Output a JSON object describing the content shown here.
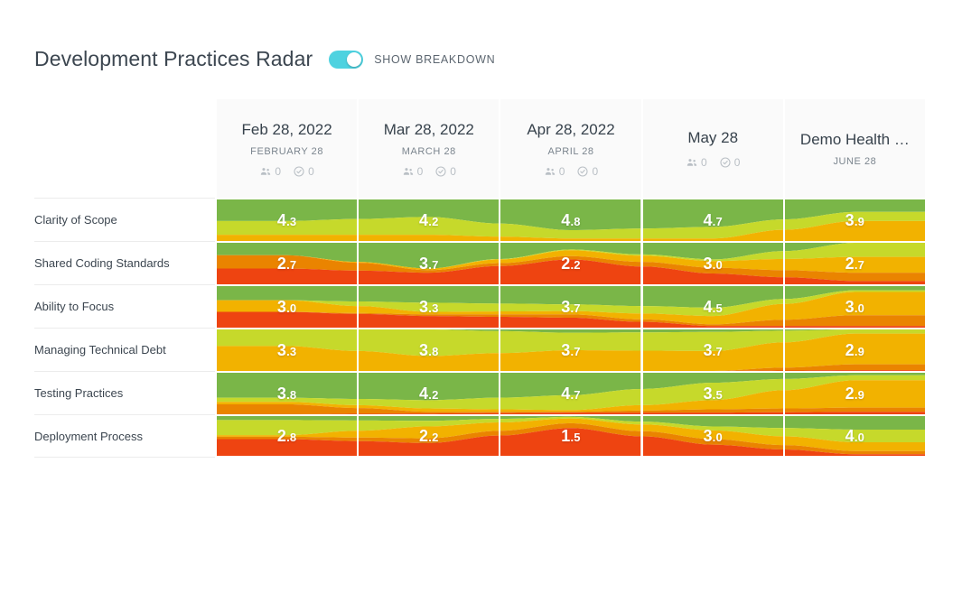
{
  "header": {
    "title": "Development Practices Radar",
    "toggle_label": "SHOW BREAKDOWN",
    "toggle_on": true,
    "toggle_color": "#4ed2e0"
  },
  "columns": [
    {
      "title": "Feb 28, 2022",
      "subtitle": "FEBRUARY 28",
      "people_count": "0",
      "checks_count": "0",
      "has_metrics": true
    },
    {
      "title": "Mar 28, 2022",
      "subtitle": "MARCH 28",
      "people_count": "0",
      "checks_count": "0",
      "has_metrics": true
    },
    {
      "title": "Apr 28, 2022",
      "subtitle": "APRIL 28",
      "people_count": "0",
      "checks_count": "0",
      "has_metrics": true
    },
    {
      "title": "May 28",
      "subtitle": "",
      "people_count": "0",
      "checks_count": "0",
      "has_metrics": true
    },
    {
      "title": "Demo Health …",
      "subtitle": "JUNE 28",
      "people_count": "",
      "checks_count": "",
      "has_metrics": false
    }
  ],
  "rows": [
    {
      "label": "Clarity of Scope"
    },
    {
      "label": "Shared Coding Standards"
    },
    {
      "label": "Ability to Focus"
    },
    {
      "label": "Managing Technical Debt"
    },
    {
      "label": "Testing Practices"
    },
    {
      "label": "Deployment Process"
    }
  ],
  "palette": {
    "green": "#7ab648",
    "yellow_green": "#c6d92b",
    "amber": "#f2b200",
    "orange": "#ea8400",
    "red": "#ee4411"
  },
  "chart_data": {
    "type": "heatmap",
    "title": "Development Practices Radar",
    "xlabel": "",
    "ylabel": "",
    "value_range": [
      1,
      5
    ],
    "categories": [
      "Feb 28, 2022",
      "Mar 28, 2022",
      "Apr 28, 2022",
      "May 28",
      "Demo Health …"
    ],
    "series": [
      {
        "name": "Clarity of Scope",
        "values": [
          4.3,
          4.2,
          4.8,
          4.7,
          3.9
        ]
      },
      {
        "name": "Shared Coding Standards",
        "values": [
          2.7,
          3.7,
          2.2,
          3.0,
          2.7
        ]
      },
      {
        "name": "Ability to Focus",
        "values": [
          3.0,
          3.3,
          3.7,
          4.5,
          3.0
        ]
      },
      {
        "name": "Managing Technical Debt",
        "values": [
          3.3,
          3.8,
          3.7,
          3.7,
          2.9
        ]
      },
      {
        "name": "Testing Practices",
        "values": [
          3.8,
          4.2,
          4.7,
          3.5,
          2.9
        ]
      },
      {
        "name": "Deployment Process",
        "values": [
          2.8,
          2.2,
          1.5,
          3.0,
          4.0
        ]
      }
    ],
    "breakdown": {
      "description": "Each cell is a stacked stream of 5 response-bucket bands (green, yellow-green, amber, orange, red) flowing between columns.",
      "band_colors": [
        "#7ab648",
        "#c6d92b",
        "#f2b200",
        "#ea8400",
        "#ee4411"
      ],
      "bands": {
        "Clarity of Scope": [
          [
            0.52,
            0.33,
            0.15,
            0.0,
            0.0
          ],
          [
            0.42,
            0.43,
            0.15,
            0.0,
            0.0
          ],
          [
            0.74,
            0.2,
            0.06,
            0.0,
            0.0
          ],
          [
            0.66,
            0.28,
            0.06,
            0.0,
            0.0
          ],
          [
            0.3,
            0.22,
            0.48,
            0.0,
            0.0
          ]
        ],
        "Shared Coding Standards": [
          [
            0.3,
            0.0,
            0.0,
            0.32,
            0.38
          ],
          [
            0.62,
            0.0,
            0.04,
            0.06,
            0.28
          ],
          [
            0.16,
            0.02,
            0.14,
            0.08,
            0.6
          ],
          [
            0.4,
            0.04,
            0.16,
            0.14,
            0.26
          ],
          [
            0.0,
            0.34,
            0.38,
            0.2,
            0.08
          ]
        ],
        "Ability to Focus": [
          [
            0.34,
            0.0,
            0.28,
            0.0,
            0.38
          ],
          [
            0.4,
            0.22,
            0.06,
            0.04,
            0.28
          ],
          [
            0.44,
            0.16,
            0.08,
            0.08,
            0.24
          ],
          [
            0.52,
            0.2,
            0.2,
            0.04,
            0.04
          ],
          [
            0.1,
            0.04,
            0.56,
            0.26,
            0.04
          ]
        ],
        "Managing Technical Debt": [
          [
            0.0,
            0.4,
            0.6,
            0.0,
            0.0
          ],
          [
            0.0,
            0.64,
            0.36,
            0.0,
            0.0
          ],
          [
            0.08,
            0.42,
            0.5,
            0.0,
            0.0
          ],
          [
            0.06,
            0.46,
            0.48,
            0.0,
            0.0
          ],
          [
            0.0,
            0.1,
            0.74,
            0.14,
            0.02
          ]
        ],
        "Testing Practices": [
          [
            0.6,
            0.1,
            0.06,
            0.24,
            0.0
          ],
          [
            0.66,
            0.2,
            0.08,
            0.04,
            0.02
          ],
          [
            0.54,
            0.36,
            0.04,
            0.02,
            0.04
          ],
          [
            0.24,
            0.42,
            0.22,
            0.08,
            0.04
          ],
          [
            0.06,
            0.12,
            0.66,
            0.1,
            0.06
          ]
        ],
        "Deployment Process": [
          [
            0.1,
            0.38,
            0.04,
            0.06,
            0.42
          ],
          [
            0.12,
            0.14,
            0.3,
            0.12,
            0.32
          ],
          [
            0.02,
            0.04,
            0.12,
            0.12,
            0.7
          ],
          [
            0.26,
            0.1,
            0.22,
            0.14,
            0.28
          ],
          [
            0.34,
            0.32,
            0.22,
            0.08,
            0.04
          ]
        ]
      }
    }
  }
}
